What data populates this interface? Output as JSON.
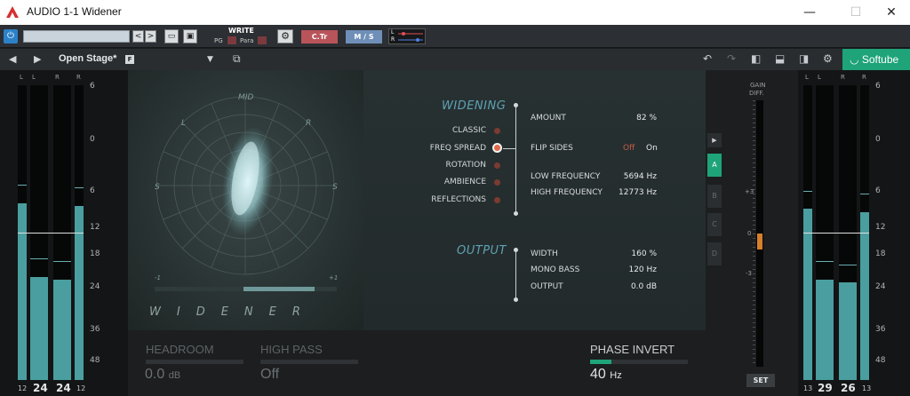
{
  "window": {
    "title": "AUDIO 1-1 Widener",
    "minimize_glyph": "—",
    "maximize_glyph": "☐",
    "close_glyph": "✕"
  },
  "host_toolbar": {
    "preset_value": "",
    "write_label": "WRITE",
    "pg_label": "PG",
    "para_label": "Para",
    "ctr_label": "C.Tr",
    "ms_label": "M / S",
    "lr_l": "L",
    "lr_r": "R",
    "prev_glyph": "<",
    "next_glyph": ">",
    "power_glyph": "⏻",
    "folder_glyph": "▭",
    "save_glyph": "▣",
    "gear_glyph": "⚙",
    "colors": {
      "power": "#2c82c9",
      "ctr": "#b9545b",
      "ms": "#6f8fb8"
    }
  },
  "plugin_nav": {
    "prev_glyph": "◀",
    "next_glyph": "▶",
    "preset_name": "Open Stage*",
    "badge": "F",
    "dropdown_glyph": "▼",
    "compare_glyph": "⧉",
    "undo_glyph": "↶",
    "redo_glyph": "↷",
    "view1_glyph": "◧",
    "view2_glyph": "⬓",
    "view3_glyph": "◨",
    "settings_glyph": "⚙",
    "brand": "Softube",
    "brand_glyph": "◡",
    "brand_color": "#1fa379"
  },
  "input_meters": {
    "channel_labels": [
      "L",
      "L",
      "R",
      "R"
    ],
    "scale": [
      "6",
      "0",
      "6",
      "12",
      "18",
      "24",
      "36",
      "48"
    ],
    "bottom": [
      "12",
      "24",
      "24",
      "12"
    ],
    "levels": [
      0.6,
      0.35,
      0.34,
      0.59
    ],
    "peaks": [
      0.66,
      0.41,
      0.4,
      0.65
    ]
  },
  "output_meters": {
    "channel_labels": [
      "L",
      "L",
      "R",
      "R"
    ],
    "scale": [
      "6",
      "0",
      "6",
      "12",
      "18",
      "24",
      "36",
      "48"
    ],
    "bottom": [
      "13",
      "29",
      "26",
      "13"
    ],
    "levels": [
      0.58,
      0.34,
      0.33,
      0.57
    ],
    "peaks": [
      0.64,
      0.4,
      0.39,
      0.63
    ]
  },
  "scope": {
    "mid_label": "MID",
    "l_label": "L",
    "r_label": "R",
    "s_left_label": "S",
    "s_right_label": "S",
    "minus_label": "-1",
    "plus_label": "+1",
    "logo_text": "WIDENER"
  },
  "widening": {
    "title": "WIDENING",
    "modes": [
      "CLASSIC",
      "FREQ SPREAD",
      "ROTATION",
      "AMBIENCE",
      "REFLECTIONS"
    ],
    "active_mode": "FREQ SPREAD",
    "amount_label": "AMOUNT",
    "amount_value": "82 %",
    "flip_label": "FLIP SIDES",
    "flip_off": "Off",
    "flip_on": "On",
    "low_freq_label": "LOW FREQUENCY",
    "low_freq_value": "5694 Hz",
    "high_freq_label": "HIGH FREQUENCY",
    "high_freq_value": "12773 Hz"
  },
  "output": {
    "title": "OUTPUT",
    "width_label": "WIDTH",
    "width_value": "160 %",
    "mono_bass_label": "MONO BASS",
    "mono_bass_value": "120 Hz",
    "output_label": "OUTPUT",
    "output_value": "0.0 dB"
  },
  "side_tabs": {
    "play_glyph": "▶",
    "tabs": [
      "A",
      "B",
      "C",
      "D"
    ],
    "active": "A"
  },
  "bottom_strip": {
    "headroom_label": "HEADROOM",
    "headroom_value": "0.0",
    "headroom_unit": "dB",
    "highpass_label": "HIGH PASS",
    "highpass_value": "Off",
    "phase_label": "PHASE INVERT",
    "phase_value": "40",
    "phase_unit": "Hz",
    "phase_level": 0.22
  },
  "gain_diff": {
    "label_line1": "GAIN",
    "label_line2": "DIFF.",
    "scale": [
      "+3",
      "0",
      "-3"
    ],
    "set_label": "SET",
    "level": 0.0
  }
}
